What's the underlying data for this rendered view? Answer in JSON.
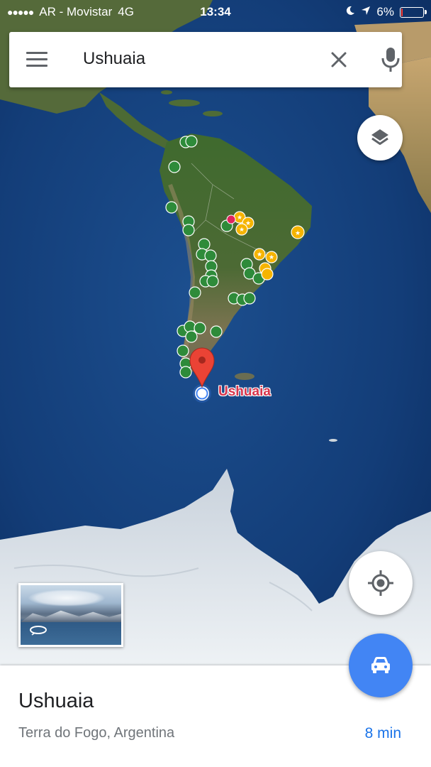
{
  "status_bar": {
    "carrier": "AR - Movistar",
    "network": "4G",
    "time": "13:34",
    "battery_percent": "6%",
    "battery_level": 0.06
  },
  "search": {
    "value": "Ushuaia"
  },
  "map": {
    "place_label": "Ushuaia",
    "pin_color": "#ea4335",
    "saved_place_color": "#2e8b3a",
    "starred_place_color": "#f5b400"
  },
  "bottom_sheet": {
    "title": "Ushuaia",
    "subtitle": "Terra do Fogo, Argentina",
    "travel_time": "8 min"
  },
  "colors": {
    "accent": "#4285f4",
    "link": "#1a73e8"
  }
}
